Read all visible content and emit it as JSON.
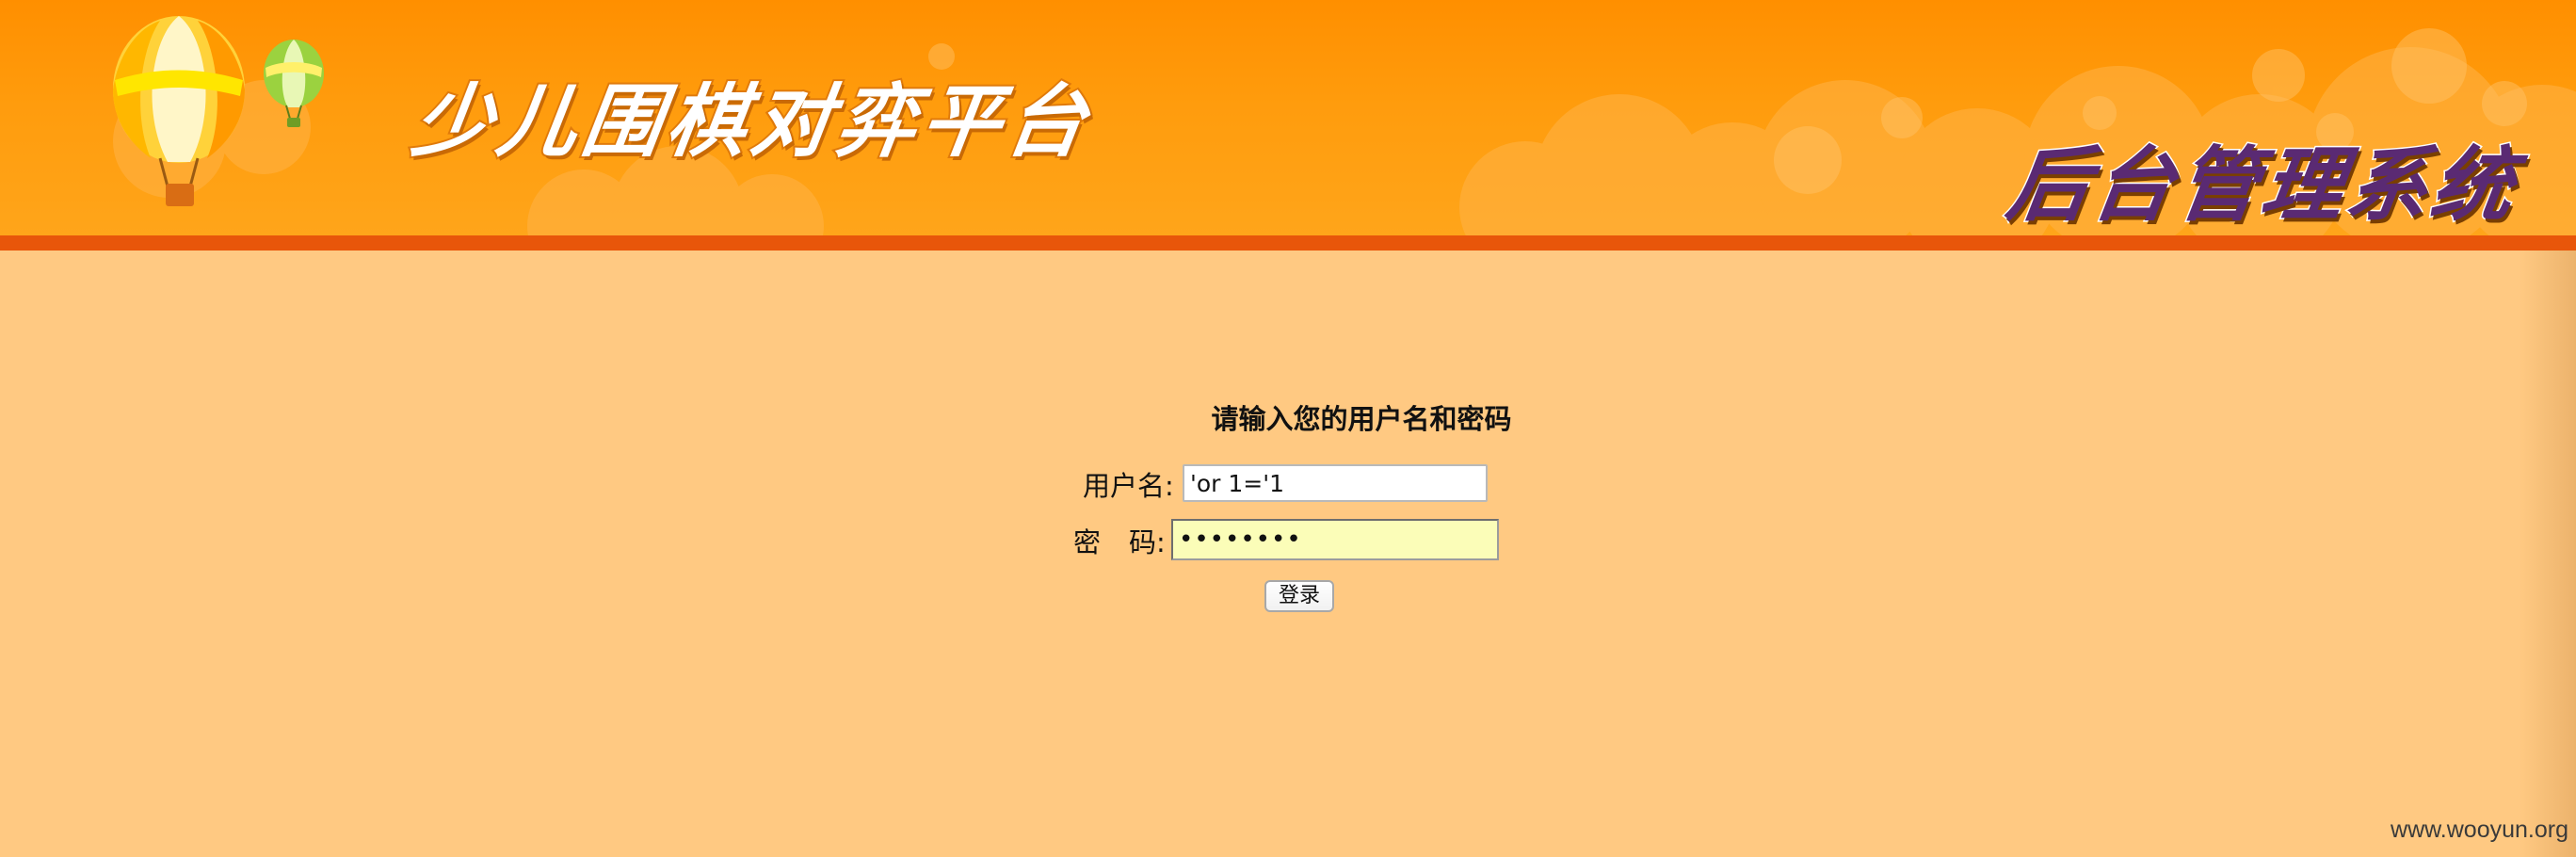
{
  "header": {
    "site_title": "少儿围棋对弈平台",
    "system_title": "后台管理系统",
    "banner_color": "#ff9c0d",
    "stripe_color": "#e8560a"
  },
  "login": {
    "prompt": "请输入您的用户名和密码",
    "username_label": "用户名:",
    "username_value": "'or 1='1",
    "password_label_first": "密",
    "password_label_second": "码:",
    "password_value": "••••••••",
    "submit_label": "登录"
  },
  "page": {
    "background_color": "#ffc982"
  },
  "watermark": "www.wooyun.org"
}
